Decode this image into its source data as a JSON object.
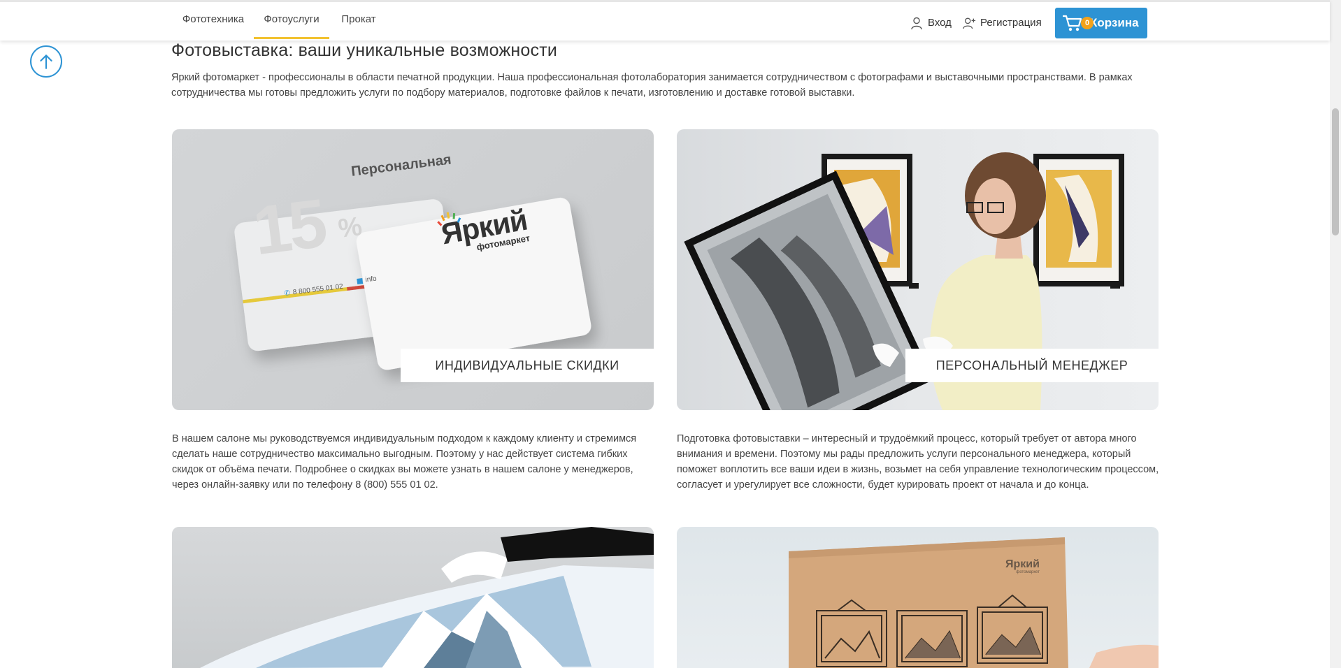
{
  "nav": {
    "tabs": [
      {
        "label": "Фототехника",
        "active": false
      },
      {
        "label": "Фотоуслуги",
        "active": true
      },
      {
        "label": "Прокат",
        "active": false
      }
    ],
    "login_label": "Вход",
    "register_label": "Регистрация",
    "cart_label": "Корзина",
    "cart_count": "0"
  },
  "colors": {
    "accent_blue": "#2d93d4",
    "active_tab_underline": "#f2c230",
    "cart_badge": "#f3a21b"
  },
  "content": {
    "title": "Фотовыставка: ваши уникальные возможности",
    "intro": "Яркий фотомаркет - профессионалы в области печатной продукции. Наша профессиональная фотолаборатория занимается сотрудничеством с фотографами и выставочными пространствами. В рамках сотрудничества мы готовы предложить услуги по подбору материалов, подготовке файлов к печати, изготовлению и доставке готовой выставки.",
    "cards": [
      {
        "label": "ИНДИВИДУАЛЬНЫЕ СКИДКИ",
        "text": "В нашем салоне мы руководствуемся индивидуальным подходом к каждому клиенту и стремимся сделать наше сотрудничество максимально выгодным. Поэтому у нас действует система гибких скидок от объёма печати. Подробнее о скидках вы можете узнать в нашем салоне у менеджеров, через онлайн-заявку или по телефону 8 (800) 555 01 02."
      },
      {
        "label": "ПЕРСОНАЛЬНЫЙ МЕНЕДЖЕР",
        "text": "Подготовка фотовыставки – интересный и трудоёмкий процесс, который требует от автора много внимания и времени. Поэтому мы рады предложить услуги персонального менеджера, который поможет воплотить все ваши идеи в жизнь, возьмет на себя управление технологическим процессом, согласует и урегулирует все сложности, будет курировать проект от начала и до конца."
      }
    ],
    "discount_card_art": {
      "big_number": "15",
      "percent": "%",
      "card_caption": "Персональная",
      "brand": "Яркий",
      "brand_sub": "фотомаркет",
      "phone": "8 800 555 01 02",
      "email_fragment": "info"
    },
    "box_art": {
      "brand": "Яркий",
      "brand_sub": "фотомаркет"
    }
  }
}
